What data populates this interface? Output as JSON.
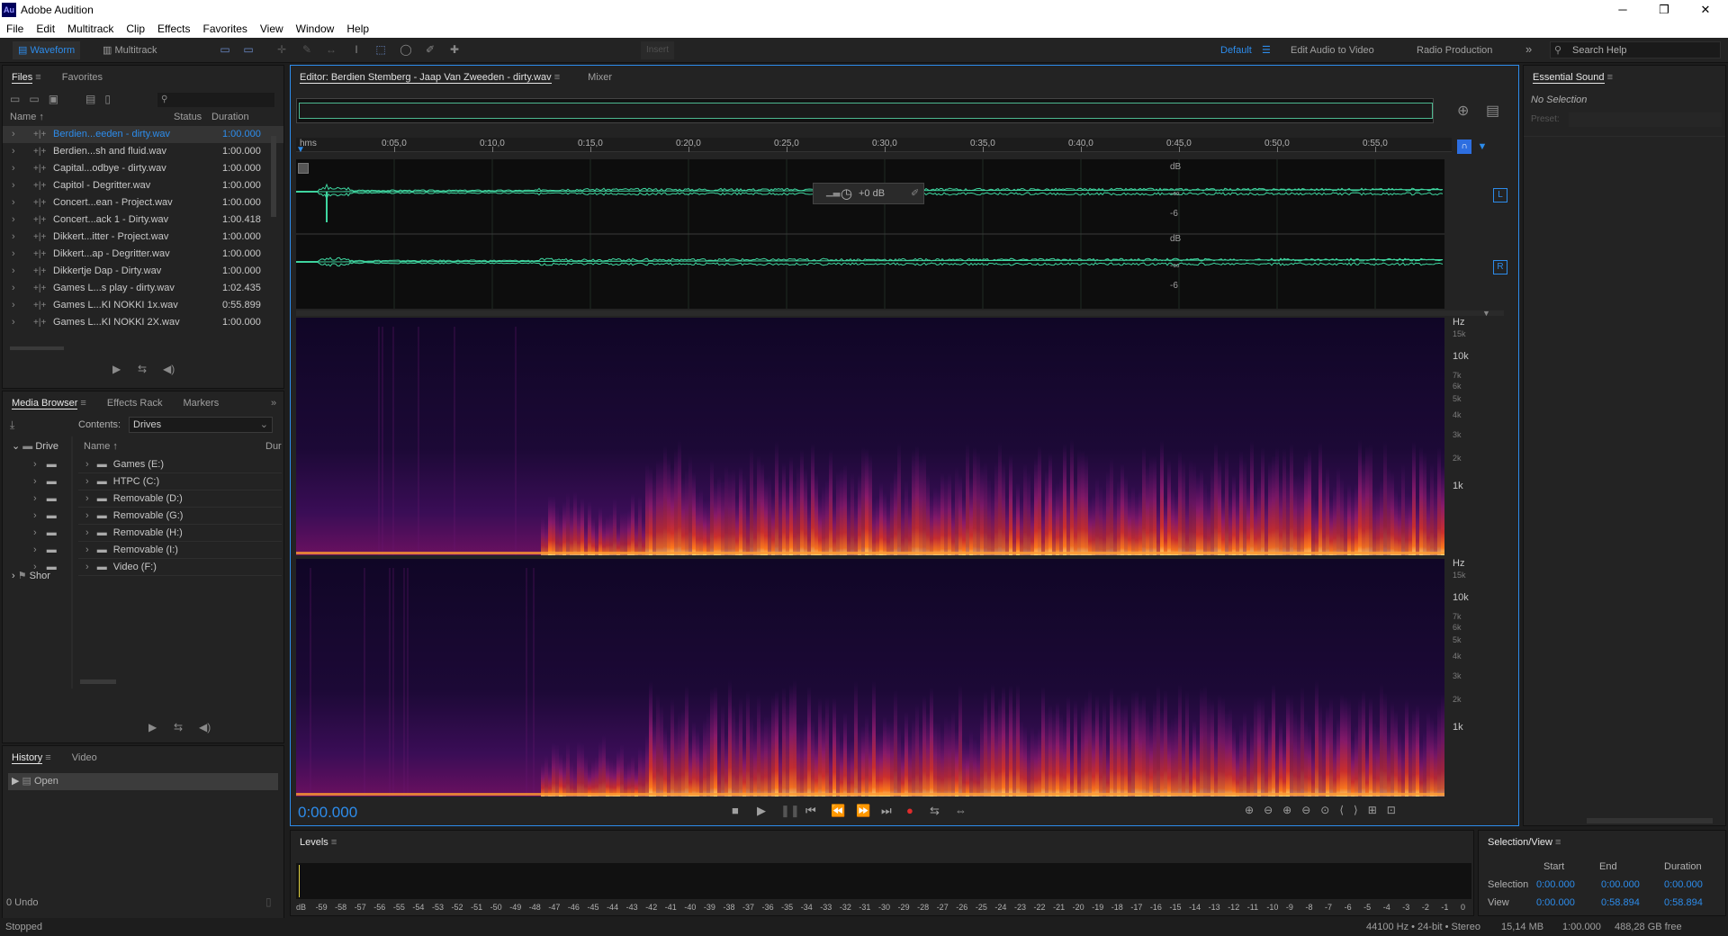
{
  "app": {
    "title": "Adobe Audition",
    "logo": "Au"
  },
  "window_controls": {
    "minimize": "─",
    "maximize": "❐",
    "close": "✕"
  },
  "menu": [
    "File",
    "Edit",
    "Multitrack",
    "Clip",
    "Effects",
    "Favorites",
    "View",
    "Window",
    "Help"
  ],
  "toolbar": {
    "waveform": "Waveform",
    "multitrack": "Multitrack",
    "insert": "Insert",
    "workspaces": [
      "Default",
      "Edit Audio to Video",
      "Radio Production"
    ],
    "search": "Search Help"
  },
  "files": {
    "tabs": [
      "Files",
      "Favorites"
    ],
    "columns": [
      "Name",
      "Status",
      "Duration"
    ],
    "rows": [
      {
        "name": "Berdien...eeden - dirty.wav",
        "duration": "1:00.000"
      },
      {
        "name": "Berdien...sh and fluid.wav",
        "duration": "1:00.000"
      },
      {
        "name": "Capital...odbye - dirty.wav",
        "duration": "1:00.000"
      },
      {
        "name": "Capitol - Degritter.wav",
        "duration": "1:00.000"
      },
      {
        "name": "Concert...ean - Project.wav",
        "duration": "1:00.000"
      },
      {
        "name": "Concert...ack 1 - Dirty.wav",
        "duration": "1:00.418"
      },
      {
        "name": "Dikkert...itter - Project.wav",
        "duration": "1:00.000"
      },
      {
        "name": "Dikkert...ap - Degritter.wav",
        "duration": "1:00.000"
      },
      {
        "name": "Dikkertje Dap - Dirty.wav",
        "duration": "1:00.000"
      },
      {
        "name": "Games L...s play - dirty.wav",
        "duration": "1:02.435"
      },
      {
        "name": "Games L...KI NOKKI 1x.wav",
        "duration": "0:55.899"
      },
      {
        "name": "Games L...KI NOKKI 2X.wav",
        "duration": "1:00.000"
      }
    ]
  },
  "media": {
    "tabs": [
      "Media Browser",
      "Effects Rack",
      "Markers"
    ],
    "contents_label": "Contents:",
    "contents_value": "Drives",
    "left_items": [
      "Drive",
      "Shor"
    ],
    "name_col": "Name",
    "dur_col": "Dur",
    "drives": [
      "Games (E:)",
      "HTPC (C:)",
      "Removable (D:)",
      "Removable (G:)",
      "Removable (H:)",
      "Removable (I:)",
      "Video (F:)"
    ]
  },
  "history": {
    "tabs": [
      "History",
      "Video"
    ],
    "item": "Open",
    "undo": "0 Undo"
  },
  "editor": {
    "tab": "Editor: Berdien Stemberg - Jaap Van Zweeden - dirty.wav",
    "mixer": "Mixer",
    "time": "0:00.000",
    "hud_gain": "+0 dB",
    "ruler": [
      "hms",
      "0:05,0",
      "0:10,0",
      "0:15,0",
      "0:20,0",
      "0:25,0",
      "0:30,0",
      "0:35,0",
      "0:40,0",
      "0:45,0",
      "0:50,0",
      "0:55,0"
    ],
    "db_labels": [
      "dB",
      "-∞",
      "-6",
      "dB",
      "-∞",
      "-6"
    ],
    "channels": [
      "L",
      "R"
    ],
    "hz_labels": [
      "Hz",
      "15k",
      "10k",
      "7k",
      "6k",
      "5k",
      "4k",
      "3k",
      "2k",
      "1k"
    ]
  },
  "essential": {
    "title": "Essential Sound",
    "selection": "No Selection",
    "preset": "Preset:"
  },
  "levels": {
    "title": "Levels",
    "scale": [
      "dB",
      "-59",
      "-58",
      "-57",
      "-56",
      "-55",
      "-54",
      "-53",
      "-52",
      "-51",
      "-50",
      "-49",
      "-48",
      "-47",
      "-46",
      "-45",
      "-44",
      "-43",
      "-42",
      "-41",
      "-40",
      "-39",
      "-38",
      "-37",
      "-36",
      "-35",
      "-34",
      "-33",
      "-32",
      "-31",
      "-30",
      "-29",
      "-28",
      "-27",
      "-26",
      "-25",
      "-24",
      "-23",
      "-22",
      "-21",
      "-20",
      "-19",
      "-18",
      "-17",
      "-16",
      "-15",
      "-14",
      "-13",
      "-12",
      "-11",
      "-10",
      "-9",
      "-8",
      "-7",
      "-6",
      "-5",
      "-4",
      "-3",
      "-2",
      "-1",
      "0"
    ]
  },
  "selview": {
    "title": "Selection/View",
    "headers": [
      "Start",
      "End",
      "Duration"
    ],
    "selection_label": "Selection",
    "view_label": "View",
    "selection": [
      "0:00.000",
      "0:00.000",
      "0:00.000"
    ],
    "view": [
      "0:00.000",
      "0:58.894",
      "0:58.894"
    ]
  },
  "status": {
    "left": "Stopped",
    "format": "44100 Hz • 24-bit • Stereo",
    "size": "15,14 MB",
    "duration": "1:00.000",
    "free": "488,28 GB free"
  },
  "colors": {
    "accent": "#2d8ceb",
    "waveform": "#3fd6a0",
    "record": "#e02c2c"
  }
}
